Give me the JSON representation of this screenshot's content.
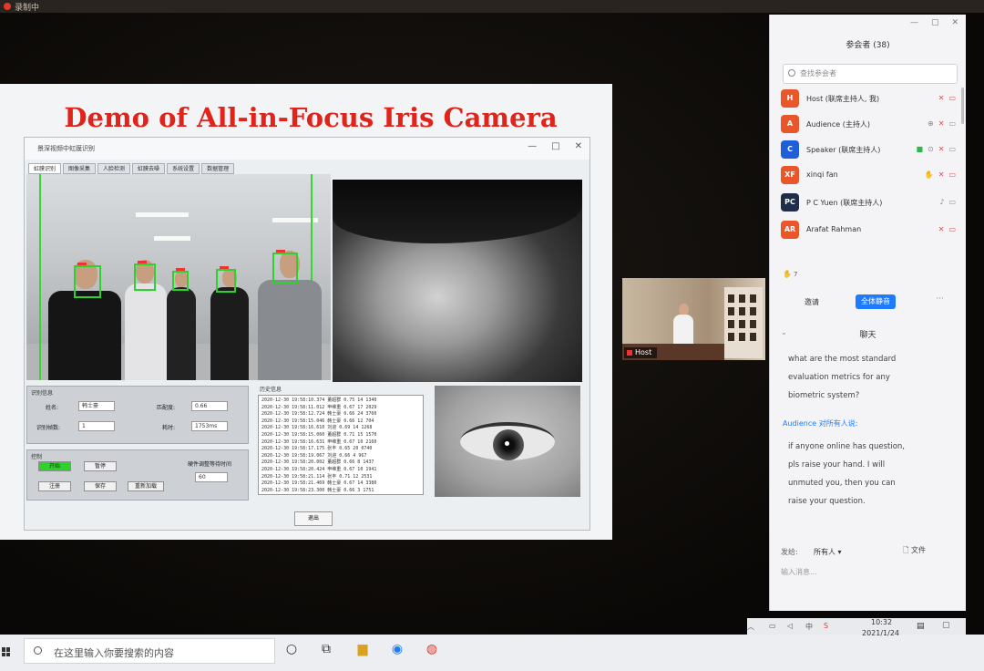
{
  "recording": {
    "label": "录制中"
  },
  "slide": {
    "title": "Demo of All-in-Focus Iris Camera",
    "app_title": "景深视频中虹膜识别",
    "window_buttons": [
      "—",
      "□",
      "✕"
    ],
    "tabs": [
      "虹膜识别",
      "图像采集",
      "人脸检测",
      "虹膜去噪",
      "系统设置",
      "数据管理"
    ],
    "info_panel": {
      "title": "识别信息",
      "name_label": "姓名:",
      "name_value": "韩士豪",
      "quality_label": "匹配度:",
      "quality_value": "0.66",
      "count_label": "识别帧数:",
      "count_value": "1",
      "time_label": "耗时:",
      "time_value": "1753ms"
    },
    "control_panel": {
      "title": "控制",
      "start": "开始",
      "pause": "暂停",
      "register": "注册",
      "save": "保存",
      "reload": "重新加载",
      "wait_label": "硬件调整等待时间",
      "wait_value": "60"
    },
    "history_title": "历史信息",
    "history": [
      "2020-12-30 19:58:10.374 董超群 0.75 14 1340",
      "2020-12-30 19:58:11.012 申维重 0.67 17 2029",
      "2020-12-30 19:58:12.724 韩士豪 0.66 24 3760",
      "2020-12-30 19:58:15.046 韩士豪 0.66 12 704",
      "2020-12-30 19:58:16.610 刘迎 0.69 14 1268",
      "2020-12-30 19:58:15.060 董超群 0.71 15 1570",
      "2020-12-30 19:58:16.631 申维重 0.67 10 2160",
      "2020-12-30 19:58:17.175 张丰 0.65 20 0740",
      "2020-12-30 19:58:19.067 刘迎 0.66 4 967",
      "2020-12-30 19:58:20.002 董超群 0.66 8 1437",
      "2020-12-30 19:58:20.424 申维重 0.67 10 1941",
      "2020-12-30 19:58:21.114 张丰 0.71 12 2531",
      "2020-12-30 19:58:21.469 韩士豪 0.67 14 3380",
      "2020-12-30 19:58:23.300 韩士豪 0.66 3 1751"
    ],
    "exit": "退出"
  },
  "speaker_video": {
    "tag": "Host"
  },
  "zoom": {
    "participants_title": "参会者 (38)",
    "search_placeholder": "查找参会者",
    "participants": [
      {
        "initials": "H",
        "name": "Host (联席主持人, 我)",
        "color": "#e8562a",
        "icons": [
          "✕",
          "▭"
        ]
      },
      {
        "initials": "A",
        "name": "Audience (主持人)",
        "color": "#e8562a",
        "icons": [
          "⊕",
          "✕",
          "▭"
        ]
      },
      {
        "initials": "C",
        "name": "Speaker (联席主持人)",
        "color": "#1e5fd8",
        "icons": [
          "■",
          "⊙",
          "✕",
          "▭"
        ]
      },
      {
        "initials": "XF",
        "name": "xinqi fan",
        "color": "#e8562a",
        "icons": [
          "✋",
          "✕",
          "▭"
        ]
      },
      {
        "initials": "PC",
        "name": "P C Yuen (联席主持人)",
        "color": "#1f2d4a",
        "icons": [
          "♪",
          "▭"
        ]
      },
      {
        "initials": "AR",
        "name": "Arafat Rahman",
        "color": "#e8562a",
        "icons": [
          "✕",
          "▭"
        ]
      }
    ],
    "raised_count": "7",
    "invite": "邀请",
    "mute_all": "全体静音",
    "more": "···",
    "chat_title": "聊天",
    "chat_message_1": "what are the most standard evaluation metrics for any biometric system?",
    "chat_from": "Audience 对所有人说:",
    "chat_message_2": "if anyone online has question, pls raise your hand. I will unmuted you, then you can raise your question.",
    "send_to_label": "发给:",
    "send_to_value": "所有人 ▾",
    "file": "文件",
    "input_placeholder": "输入消息..."
  },
  "taskbar": {
    "search_placeholder": "在这里输入你要搜索的内容",
    "time": "10:32",
    "date": "2021/1/24"
  }
}
